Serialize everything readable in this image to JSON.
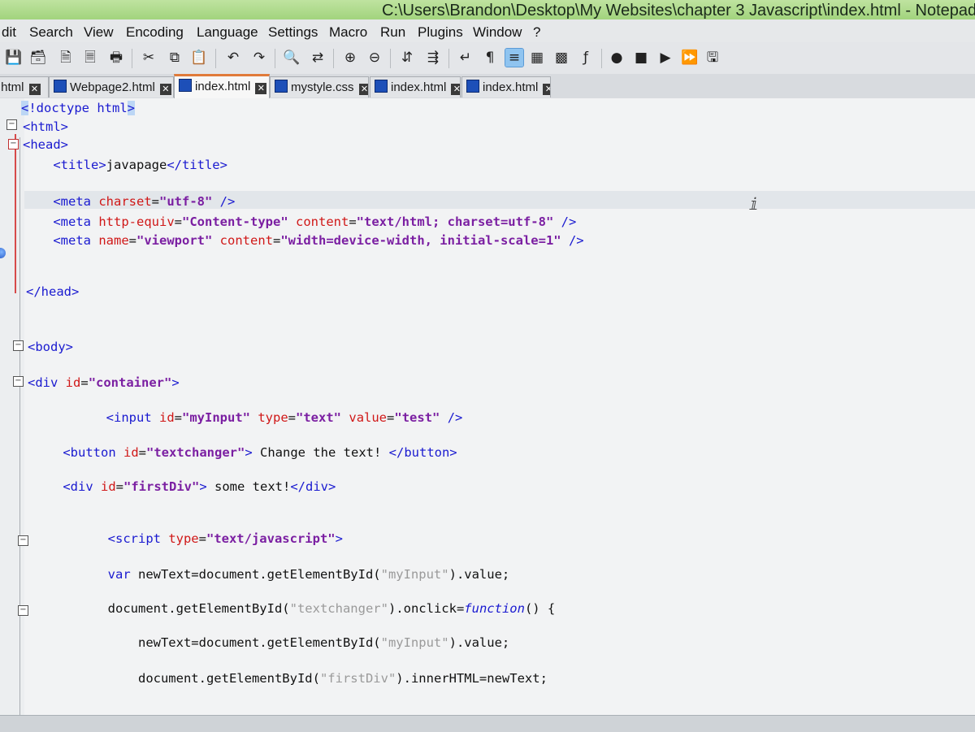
{
  "window": {
    "title": "C:\\Users\\Brandon\\Desktop\\My Websites\\chapter 3 Javascript\\index.html - Notepad++"
  },
  "menu": [
    "dit",
    "Search",
    "View",
    "Encoding",
    "Language",
    "Settings",
    "Macro",
    "Run",
    "Plugins",
    "Window",
    "?"
  ],
  "toolbar": {
    "icons": [
      "save-icon",
      "save-all-icon",
      "close-icon",
      "close-all-icon",
      "print-icon",
      "cut-icon",
      "copy-icon",
      "paste-icon",
      "undo-icon",
      "redo-icon",
      "find-icon",
      "replace-icon",
      "zoom-in-icon",
      "zoom-out-icon",
      "sync-vertical-icon",
      "sync-horizontal-icon",
      "word-wrap-icon",
      "show-all-chars-icon",
      "indent-guide-icon",
      "user-lang-icon",
      "doc-map-icon",
      "function-list-icon",
      "record-macro-icon",
      "stop-record-icon",
      "play-macro-icon",
      "run-multiple-icon",
      "save-macro-icon"
    ],
    "selected_icon": "indent-guide-icon"
  },
  "tabs": [
    {
      "label": ".html",
      "active": false
    },
    {
      "label": "Webpage2.html",
      "active": false
    },
    {
      "label": "index.html",
      "active": true
    },
    {
      "label": "mystyle.css",
      "active": false
    },
    {
      "label": "index.html",
      "active": false
    },
    {
      "label": "index.html",
      "active": false
    }
  ],
  "editor": {
    "current_line_index": 4,
    "lines": [
      {
        "text": "<!doctype html>"
      },
      {
        "text": "<html>"
      },
      {
        "text": "<head>"
      },
      {
        "text": "    <title>javapage</title>"
      },
      {
        "text": "    <meta charset=\"utf-8\" />"
      },
      {
        "text": "    <meta http-equiv=\"Content-type\" content=\"text/html; charset=utf-8\" />"
      },
      {
        "text": "    <meta name=\"viewport\" content=\"width=device-width, initial-scale=1\" />"
      },
      {
        "text": "</head>"
      },
      {
        "text": "<body>"
      },
      {
        "text": "<div id=\"container\">"
      },
      {
        "text": "        <input id=\"myInput\" type=\"text\" value=\"test\" />"
      },
      {
        "text": "    <button id=\"textchanger\"> Change the text! </button>"
      },
      {
        "text": "    <div id=\"firstDiv\"> some text!</div>"
      },
      {
        "text": "        <script type=\"text/javascript\">"
      },
      {
        "text": "        var newText=document.getElementById(\"myInput\").value;"
      },
      {
        "text": "        document.getElementById(\"textchanger\").onclick=function() {"
      },
      {
        "text": "            newText=document.getElementById(\"myInput\").value;"
      },
      {
        "text": "            document.getElementById(\"firstDiv\").innerHTML=newText;"
      }
    ]
  },
  "colors": {
    "tag": "#1a1ad0",
    "attribute": "#d01818",
    "value": "#7b1fa2",
    "string_in_script": "#9a9a9a",
    "active_tab_accent": "#e07a3a",
    "titlebar": "#9fd27a"
  }
}
